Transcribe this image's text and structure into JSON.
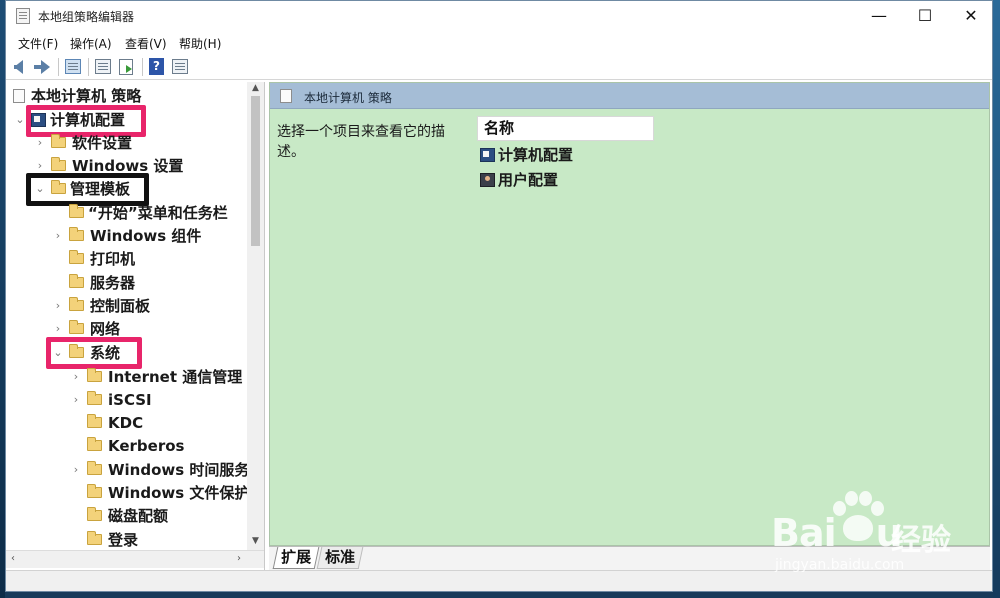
{
  "window": {
    "title": "本地组策略编辑器",
    "minimize": "—",
    "maximize": "☐",
    "close": "✕"
  },
  "menu": [
    "文件(F)",
    "操作(A)",
    "查看(V)",
    "帮助(H)"
  ],
  "toolbar": {
    "icons": [
      "back-arrow-icon",
      "forward-arrow-icon",
      "show-hide-tree-icon",
      "properties-icon",
      "export-list-icon",
      "help-icon",
      "view-icon"
    ],
    "help_glyph": "?"
  },
  "tree": {
    "root": "本地计算机 策略",
    "computer_config": "计算机配置",
    "software_settings": "软件设置",
    "windows_settings": "Windows 设置",
    "admin_templates": "管理模板",
    "start_menu": "“开始”菜单和任务栏",
    "windows_components": "Windows 组件",
    "printers": "打印机",
    "servers": "服务器",
    "control_panel": "控制面板",
    "network": "网络",
    "system": "系统",
    "internet_comm": "Internet 通信管理",
    "iscsi": "iSCSI",
    "kdc": "KDC",
    "kerberos": "Kerberos",
    "time_service": "Windows 时间服务",
    "file_protection": "Windows 文件保护",
    "disk_quota": "磁盘配额",
    "logon": "登录",
    "chevron_collapsed": "›",
    "chevron_expanded": "⌄"
  },
  "right_pane": {
    "header": "本地计算机 策略",
    "description": "选择一个项目来查看它的描述。",
    "column_header": "名称",
    "items": [
      "计算机配置",
      "用户配置"
    ]
  },
  "tabs": [
    "扩展",
    "标准"
  ],
  "scroll": {
    "up": "▲",
    "down": "▼",
    "left": "‹",
    "right": "›"
  },
  "watermark": {
    "brand_latin": "Bai",
    "brand_tail": "u",
    "brand_cn": "经验",
    "url": "jingyan.baidu.com"
  },
  "colors": {
    "highlight_pink": "#e8256a",
    "highlight_black": "#111111",
    "pane_green": "#c8e9c6",
    "header_blue": "#a5bdd6"
  }
}
